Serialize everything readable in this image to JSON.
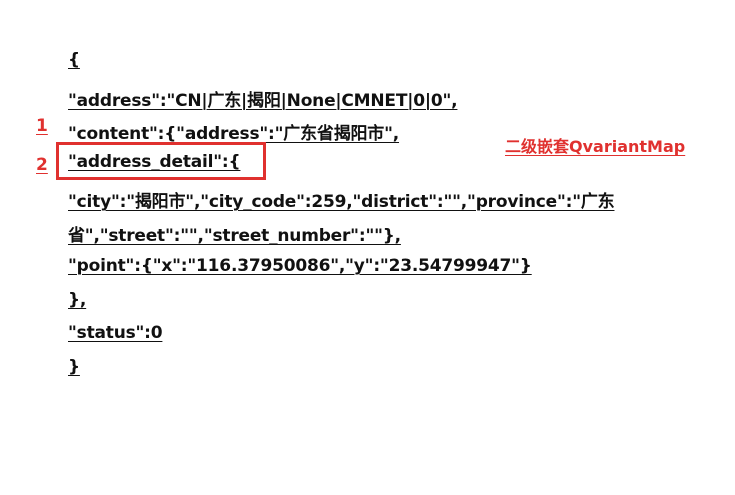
{
  "document": {
    "lines": [
      "{",
      "\"address\":\"CN|广东|揭阳|None|CMNET|0|0\",",
      "\"content\":{\"address\":\"广东省揭阳市\",",
      "\"address_detail\":{",
      "\"city\":\"揭阳市\",\"city_code\":259,\"district\":\"\",\"province\":\"广东",
      "省\",\"street\":\"\",\"street_number\":\"\"},",
      "\"point\":{\"x\":\"116.37950086\",\"y\":\"23.54799947\"}",
      "},",
      "\"status\":0",
      "}"
    ]
  },
  "annotations": {
    "marker_1": "1",
    "marker_2": "2",
    "note": "二级嵌套QvariantMap",
    "color": "#e0312f"
  }
}
